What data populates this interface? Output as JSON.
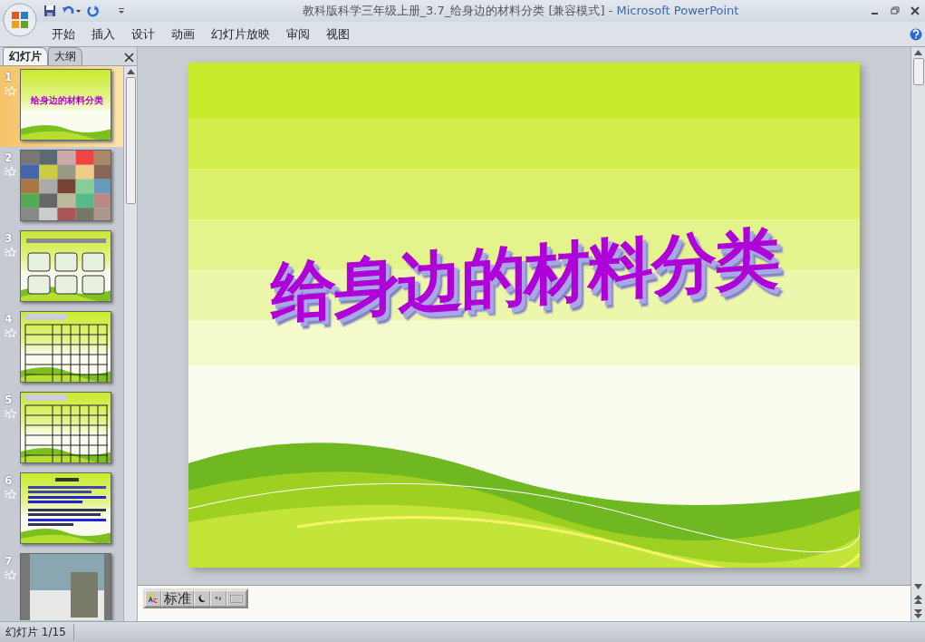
{
  "window": {
    "title": "教科版科学三年级上册_3.7_给身边的材料分类 [兼容模式]",
    "separator": "-",
    "app": "Microsoft PowerPoint"
  },
  "ribbon_tabs": [
    {
      "label": "开始",
      "selected": false
    },
    {
      "label": "插入",
      "selected": false
    },
    {
      "label": "设计",
      "selected": false
    },
    {
      "label": "动画",
      "selected": false
    },
    {
      "label": "幻灯片放映",
      "selected": false
    },
    {
      "label": "审阅",
      "selected": false
    },
    {
      "label": "视图",
      "selected": false
    }
  ],
  "panel_tabs": [
    {
      "label": "幻灯片",
      "selected": true
    },
    {
      "label": "大纲",
      "selected": false
    }
  ],
  "thumbnails": [
    {
      "number": "1",
      "selected": true,
      "kind": "title",
      "title": "给身边的材料分类"
    },
    {
      "number": "2",
      "selected": false,
      "kind": "photos"
    },
    {
      "number": "3",
      "selected": false,
      "kind": "boxes"
    },
    {
      "number": "4",
      "selected": false,
      "kind": "table"
    },
    {
      "number": "5",
      "selected": false,
      "kind": "table"
    },
    {
      "number": "6",
      "selected": false,
      "kind": "text"
    },
    {
      "number": "7",
      "selected": false,
      "kind": "photo"
    }
  ],
  "slide": {
    "title": "给身边的材料分类"
  },
  "ime_bar": {
    "mode": "标准"
  },
  "status_bar": {
    "slide_indicator": "幻灯片 1/15"
  }
}
